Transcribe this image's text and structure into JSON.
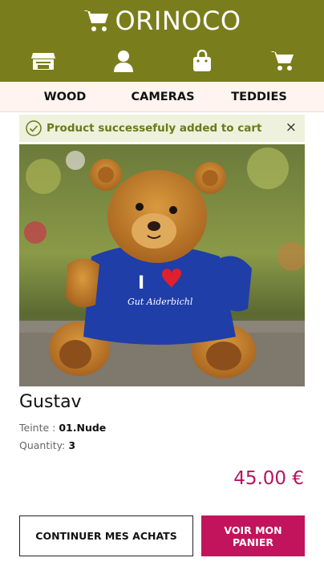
{
  "header": {
    "brand": "ORINOCO",
    "logo_icon": "shopping-cart-icon",
    "background_color": "#7a7d1b",
    "nav_icons": [
      {
        "name": "store-icon"
      },
      {
        "name": "user-icon"
      },
      {
        "name": "shopping-bag-icon"
      },
      {
        "name": "shopping-cart-icon"
      }
    ]
  },
  "categories": [
    "WOOD",
    "CAMERAS",
    "TEDDIES"
  ],
  "alert": {
    "message": "Product successefuly added to cart",
    "close_label": "×",
    "icon": "check-circle-icon"
  },
  "product": {
    "name": "Gustav",
    "image_alt": "teddy bear with blue I love Gut Aiderbichl t-shirt",
    "shirt_text": "Gut Aiderbichl",
    "shirt_top": "I",
    "color_label": "Teinte :",
    "color_value": "01.Nude",
    "quantity_label": "Quantity:",
    "quantity_value": "3",
    "price": "45.00 €",
    "price_color": "#b5145f"
  },
  "buttons": {
    "continue_label": "CONTINUER MES ACHATS",
    "cart_label": "VOIR MON PANIER",
    "cart_color": "#c2145c"
  }
}
